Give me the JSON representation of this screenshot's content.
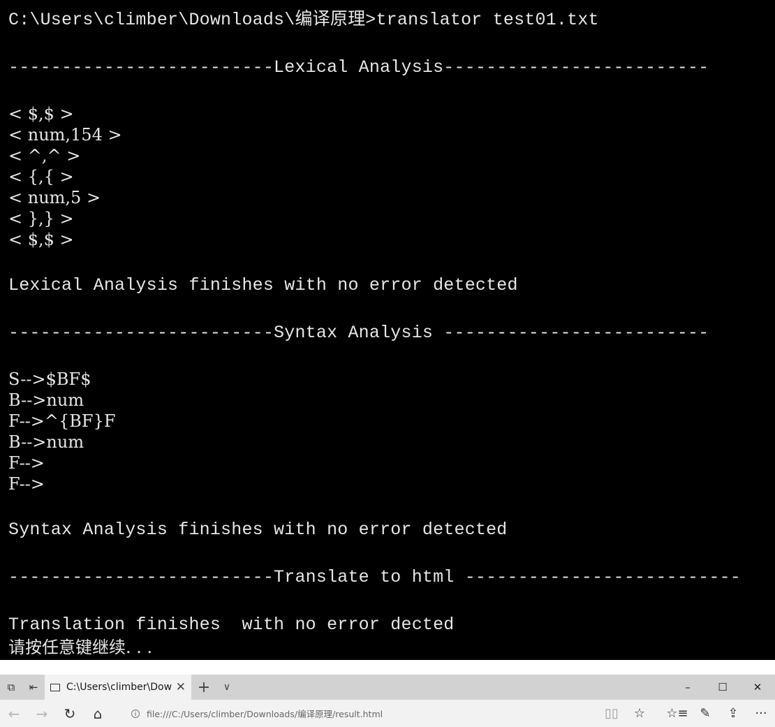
{
  "console": {
    "lines": [
      {
        "text": "C:\\Users\\climber\\Downloads\\编译原理>translator test01.txt",
        "style": "mono"
      },
      {
        "text": "",
        "style": "blank"
      },
      {
        "text": "-------------------------Lexical Analysis-------------------------",
        "style": "mono"
      },
      {
        "text": "",
        "style": "blank"
      },
      {
        "text": "< $,$ >",
        "style": "tight"
      },
      {
        "text": "< num,154 >",
        "style": "tight"
      },
      {
        "text": "< ^,^ >",
        "style": "tight"
      },
      {
        "text": "< {,{ >",
        "style": "tight"
      },
      {
        "text": "< num,5 >",
        "style": "tight"
      },
      {
        "text": "< },} >",
        "style": "tight"
      },
      {
        "text": "< $,$ >",
        "style": "tight"
      },
      {
        "text": "",
        "style": "blank"
      },
      {
        "text": "Lexical Analysis finishes with no error detected",
        "style": "mono"
      },
      {
        "text": "",
        "style": "blank"
      },
      {
        "text": "-------------------------Syntax Analysis -------------------------",
        "style": "mono"
      },
      {
        "text": "",
        "style": "blank"
      },
      {
        "text": "S-->$BF$",
        "style": "tight"
      },
      {
        "text": "B-->num",
        "style": "tight"
      },
      {
        "text": "F-->^{BF}F",
        "style": "tight"
      },
      {
        "text": "B-->num",
        "style": "tight"
      },
      {
        "text": "F-->",
        "style": "tight"
      },
      {
        "text": "F-->",
        "style": "tight"
      },
      {
        "text": "",
        "style": "blank"
      },
      {
        "text": "Syntax Analysis finishes with no error detected",
        "style": "mono"
      },
      {
        "text": "",
        "style": "blank"
      },
      {
        "text": "-------------------------Translate to html --------------------------",
        "style": "mono"
      },
      {
        "text": "",
        "style": "blank"
      },
      {
        "text": "Translation finishes  with no error dected",
        "style": "mono"
      },
      {
        "text": "请按任意键继续. . .",
        "style": "tight"
      }
    ]
  },
  "browser": {
    "tab": {
      "title": "C:\\Users\\climber\\Downl",
      "close_glyph": "✕"
    },
    "tab_actions": {
      "new_tab_glyph": "+",
      "tab_list_glyph": "∨"
    },
    "window_controls": {
      "minimize": "–",
      "maximize": "☐",
      "close": "✕"
    },
    "nav": {
      "back": "←",
      "forward": "→",
      "refresh": "↻",
      "home": "⌂"
    },
    "address": {
      "info_glyph": "i",
      "url": "file:///C:/Users/climber/Downloads/编译原理/result.html"
    },
    "tools": {
      "reading_view": "▯▯",
      "favorite": "☆",
      "favorites_list": "☆≡",
      "notes": "✎",
      "share": "⇪",
      "more": "···"
    },
    "colors": {
      "console_bg": "#000000",
      "console_text": "#e6e6e6",
      "tabbar_bg": "#d2d2d2",
      "active_tab_bg": "#f2f2f2"
    }
  }
}
